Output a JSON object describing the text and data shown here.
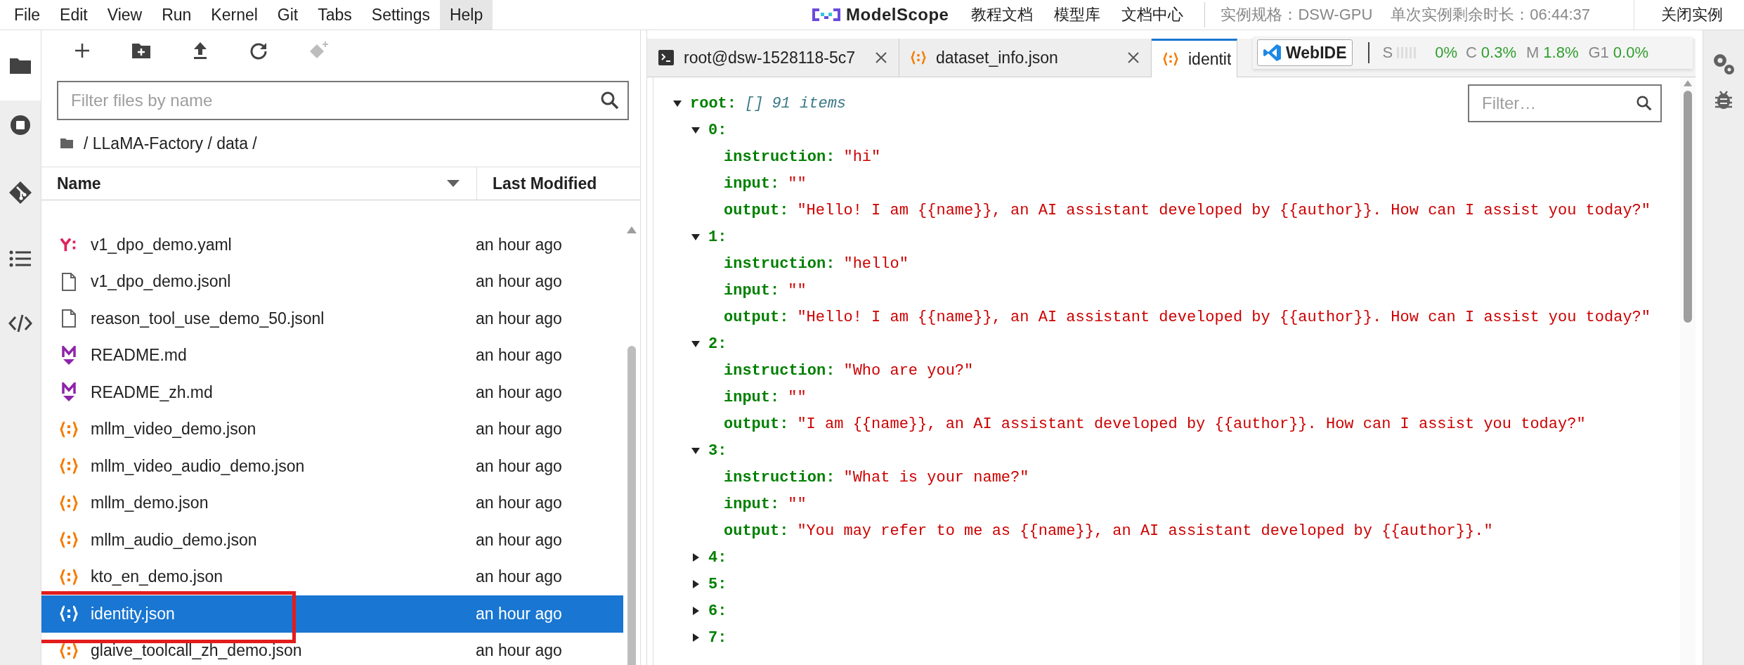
{
  "menu": [
    {
      "label": "File",
      "selected": false
    },
    {
      "label": "Edit",
      "selected": false
    },
    {
      "label": "View",
      "selected": false
    },
    {
      "label": "Run",
      "selected": false
    },
    {
      "label": "Kernel",
      "selected": false
    },
    {
      "label": "Git",
      "selected": false
    },
    {
      "label": "Tabs",
      "selected": false
    },
    {
      "label": "Settings",
      "selected": false
    },
    {
      "label": "Help",
      "selected": true
    }
  ],
  "topbar": {
    "logo": "ModelScope",
    "links": [
      "教程文档",
      "模型库",
      "文档中心"
    ],
    "spec": "实例规格：DSW-GPU",
    "remaining": "单次实例剩余时长：06:44:37",
    "close": "关闭实例"
  },
  "file_browser": {
    "filter_placeholder": "Filter files by name",
    "breadcrumb": "/ LLaMA-Factory / data /",
    "columns": [
      "Name",
      "Last Modified"
    ],
    "files": [
      {
        "name": "v1_dpo_demo.yaml",
        "modified": "an hour ago",
        "kind": "yaml",
        "selected": false
      },
      {
        "name": "v1_dpo_demo.jsonl",
        "modified": "an hour ago",
        "kind": "text",
        "selected": false
      },
      {
        "name": "reason_tool_use_demo_50.jsonl",
        "modified": "an hour ago",
        "kind": "text",
        "selected": false
      },
      {
        "name": "README.md",
        "modified": "an hour ago",
        "kind": "markdown",
        "selected": false
      },
      {
        "name": "README_zh.md",
        "modified": "an hour ago",
        "kind": "markdown",
        "selected": false
      },
      {
        "name": "mllm_video_demo.json",
        "modified": "an hour ago",
        "kind": "json",
        "selected": false
      },
      {
        "name": "mllm_video_audio_demo.json",
        "modified": "an hour ago",
        "kind": "json",
        "selected": false
      },
      {
        "name": "mllm_demo.json",
        "modified": "an hour ago",
        "kind": "json",
        "selected": false
      },
      {
        "name": "mllm_audio_demo.json",
        "modified": "an hour ago",
        "kind": "json",
        "selected": false
      },
      {
        "name": "kto_en_demo.json",
        "modified": "an hour ago",
        "kind": "json",
        "selected": false
      },
      {
        "name": "identity.json",
        "modified": "an hour ago",
        "kind": "json",
        "selected": true
      },
      {
        "name": "glaive_toolcall_zh_demo.json",
        "modified": "an hour ago",
        "kind": "json",
        "selected": false
      }
    ]
  },
  "tabs": [
    {
      "label": "root@dsw-1528118-5c7",
      "kind": "terminal",
      "selected": false
    },
    {
      "label": "dataset_info.json",
      "kind": "json",
      "selected": false
    },
    {
      "label": "identit",
      "kind": "json",
      "selected": true
    }
  ],
  "resource_popup": {
    "button": "WebIDE",
    "items": [
      {
        "label": "S",
        "value": "0%",
        "kind": "bars"
      },
      {
        "label": "C",
        "value": "0.3%",
        "kind": "plain"
      },
      {
        "label": "M",
        "value": "1.8%",
        "kind": "plain"
      },
      {
        "label": "G1",
        "value": "0.0%",
        "kind": "plain"
      }
    ]
  },
  "json_viewer": {
    "filter_placeholder": "Filter…",
    "root": {
      "key": "root:",
      "type": "[]",
      "count": "91 items",
      "expanded": true
    },
    "items": [
      {
        "key": "0:",
        "expanded": true,
        "fields": [
          {
            "key": "instruction:",
            "value": "\"hi\""
          },
          {
            "key": "input:",
            "value": "\"\""
          },
          {
            "key": "output:",
            "value": "\"Hello! I am {{name}}, an AI assistant developed by {{author}}. How can I assist you today?\""
          }
        ]
      },
      {
        "key": "1:",
        "expanded": true,
        "fields": [
          {
            "key": "instruction:",
            "value": "\"hello\""
          },
          {
            "key": "input:",
            "value": "\"\""
          },
          {
            "key": "output:",
            "value": "\"Hello! I am {{name}}, an AI assistant developed by {{author}}. How can I assist you today?\""
          }
        ]
      },
      {
        "key": "2:",
        "expanded": true,
        "fields": [
          {
            "key": "instruction:",
            "value": "\"Who are you?\""
          },
          {
            "key": "input:",
            "value": "\"\""
          },
          {
            "key": "output:",
            "value": "\"I am {{name}}, an AI assistant developed by {{author}}. How can I assist you today?\""
          }
        ]
      },
      {
        "key": "3:",
        "expanded": true,
        "fields": [
          {
            "key": "instruction:",
            "value": "\"What is your name?\""
          },
          {
            "key": "input:",
            "value": "\"\""
          },
          {
            "key": "output:",
            "value": "\"You may refer to me as {{name}}, an AI assistant developed by {{author}}.\""
          }
        ]
      },
      {
        "key": "4:",
        "expanded": false
      },
      {
        "key": "5:",
        "expanded": false
      },
      {
        "key": "6:",
        "expanded": false
      },
      {
        "key": "7:",
        "expanded": false
      }
    ]
  }
}
